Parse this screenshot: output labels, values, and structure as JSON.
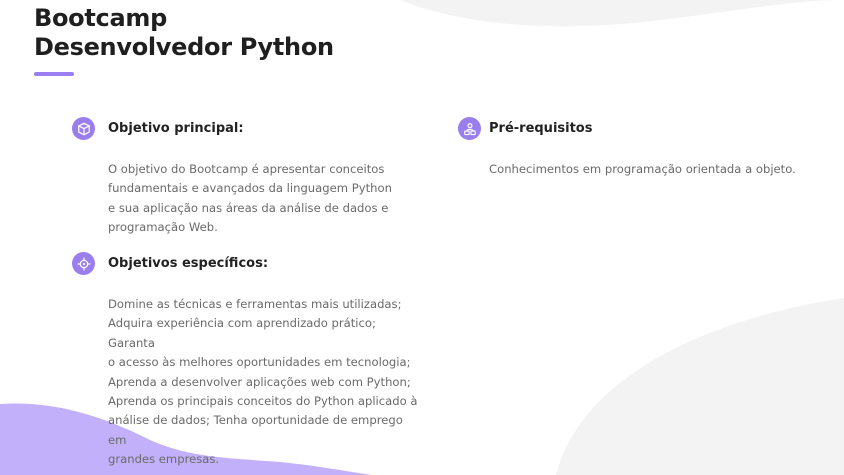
{
  "page": {
    "title_line1": "Bootcamp",
    "title_line2": "Desenvolvedor Python"
  },
  "colors": {
    "accent": "#9a7eee",
    "decor_purple": "#c3b0fb",
    "decor_gray": "#f3f3f3"
  },
  "sections": [
    {
      "icon": "cube-icon",
      "title": "Objetivo principal:",
      "lines": [
        "O objetivo do Bootcamp é apresentar conceitos",
        "fundamentais e avançados da linguagem Python",
        "e sua aplicação nas áreas da análise de dados e",
        "programação Web."
      ]
    },
    {
      "icon": "target-icon",
      "title": "Objetivos específicos:",
      "lines": [
        "Domine as técnicas e ferramentas mais utilizadas;",
        "Adquira experiência com aprendizado prático; Garanta",
        "o acesso às melhores oportunidades em tecnologia;",
        "Aprenda a desenvolver aplicações web com Python;",
        "Aprenda os principais conceitos do Python aplicado à",
        "análise de dados; Tenha oportunidade de emprego em",
        "grandes empresas."
      ]
    },
    {
      "icon": "users-icon",
      "title": "Pré-requisitos",
      "lines": [
        "Conhecimentos em programação orientada a objeto."
      ]
    }
  ]
}
